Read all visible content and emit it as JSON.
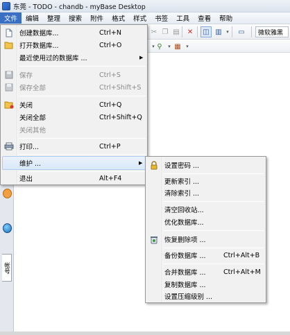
{
  "window": {
    "title": "东莞 - TODO - chandb - myBase Desktop"
  },
  "menubar": [
    {
      "label": "文件",
      "active": true
    },
    {
      "label": "编辑"
    },
    {
      "label": "整理"
    },
    {
      "label": "搜索"
    },
    {
      "label": "附件"
    },
    {
      "label": "格式"
    },
    {
      "label": "样式"
    },
    {
      "label": "书签"
    },
    {
      "label": "工具"
    },
    {
      "label": "查看"
    },
    {
      "label": "帮助"
    }
  ],
  "toolbar": {
    "font_value": "微软雅黑"
  },
  "side_tab": {
    "label": "帐号"
  },
  "file_menu": {
    "items": [
      {
        "label": "创建数据库...",
        "shortcut": "Ctrl+N",
        "icon": "new-document-icon"
      },
      {
        "label": "打开数据库...",
        "shortcut": "Ctrl+O",
        "icon": "open-folder-icon"
      },
      {
        "label": "最近使用过的数据库 ...",
        "shortcut": "",
        "submenu": true
      },
      {
        "label": "保存",
        "shortcut": "Ctrl+S",
        "disabled": true,
        "icon": "save-icon"
      },
      {
        "label": "保存全部",
        "shortcut": "Ctrl+Shift+S",
        "disabled": true,
        "icon": "save-all-icon"
      },
      {
        "label": "关闭",
        "shortcut": "Ctrl+Q",
        "icon": "close-folder-icon"
      },
      {
        "label": "关闭全部",
        "shortcut": "Ctrl+Shift+Q"
      },
      {
        "label": "关闭其他",
        "shortcut": "",
        "disabled": true
      },
      {
        "label": "打印...",
        "shortcut": "Ctrl+P",
        "icon": "printer-icon"
      },
      {
        "label": "维护 ...",
        "shortcut": "",
        "submenu": true,
        "highlighted": true
      },
      {
        "label": "退出",
        "shortcut": "Alt+F4"
      }
    ]
  },
  "maintenance_menu": {
    "items": [
      {
        "label": "设置密码 ...",
        "shortcut": "",
        "icon": "lock-icon"
      },
      {
        "label": "更新索引 ...",
        "shortcut": ""
      },
      {
        "label": "清除索引 ...",
        "shortcut": ""
      },
      {
        "label": "清空回收站...",
        "shortcut": ""
      },
      {
        "label": "优化数据库...",
        "shortcut": ""
      },
      {
        "label": "恢复删除项 ...",
        "shortcut": "",
        "icon": "recycle-restore-icon"
      },
      {
        "label": "备份数据库 ...",
        "shortcut": "Ctrl+Alt+B"
      },
      {
        "label": "合并数据库 ...",
        "shortcut": "Ctrl+Alt+M"
      },
      {
        "label": "复制数据库 ...",
        "shortcut": ""
      },
      {
        "label": "设置压缩级别 ...",
        "shortcut": ""
      }
    ]
  },
  "colors": {
    "menu_active": "#3a6fc4",
    "highlight_border": "#aecbee"
  }
}
